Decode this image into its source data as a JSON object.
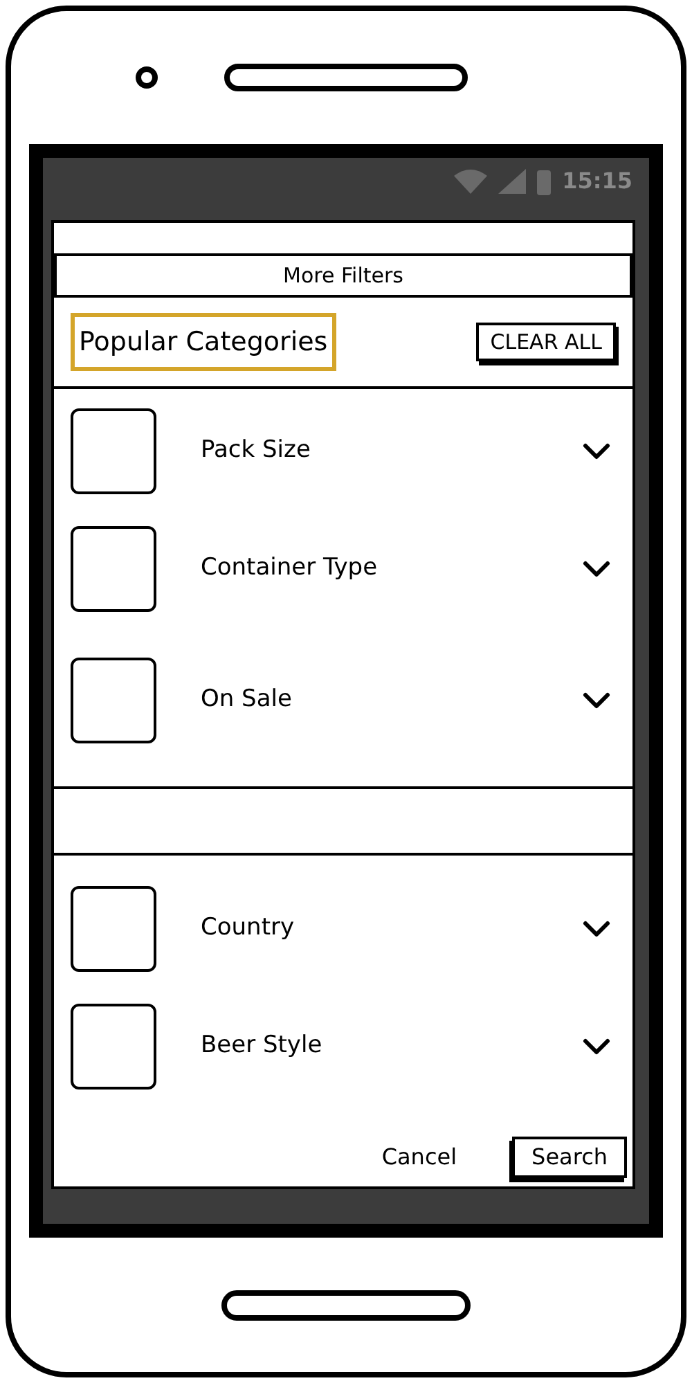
{
  "status_bar": {
    "time": "15:15"
  },
  "dialog": {
    "title": "More Filters",
    "section_title": "Popular Categories",
    "clear_button": "CLEAR ALL",
    "groups": [
      {
        "items": [
          {
            "label": "Pack Size",
            "checked": false
          },
          {
            "label": "Container Type",
            "checked": false
          },
          {
            "label": "On Sale",
            "checked": false
          }
        ]
      },
      {
        "items": [
          {
            "label": "Country",
            "checked": false
          },
          {
            "label": "Beer Style",
            "checked": false
          }
        ]
      }
    ],
    "buttons": {
      "cancel": "Cancel",
      "search": "Search"
    }
  }
}
